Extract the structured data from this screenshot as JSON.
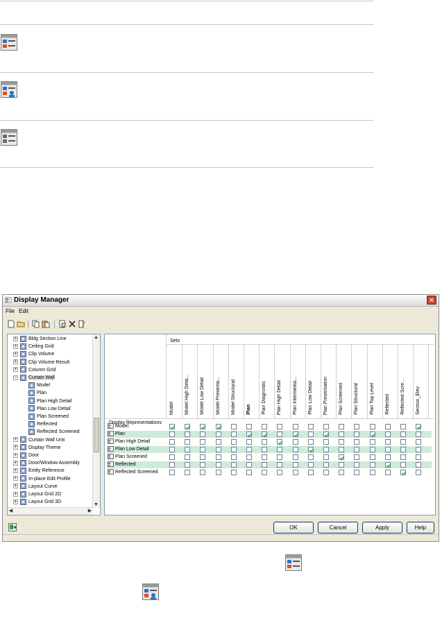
{
  "dialog": {
    "title": "Display Manager",
    "menu": [
      "File",
      "Edit"
    ],
    "close_glyph": "✕",
    "icons": {
      "app": "display-manager-icon",
      "toolbar": [
        "new-icon",
        "open-icon",
        "copy-icon",
        "paste-icon",
        "attach-icon",
        "delete-icon",
        "edit-icon"
      ],
      "export": "export-icon"
    }
  },
  "tree": {
    "items": [
      {
        "label": "Bldg Section Line",
        "level": 0,
        "expander": "+"
      },
      {
        "label": "Ceiling Grid",
        "level": 0,
        "expander": "+"
      },
      {
        "label": "Clip Volume",
        "level": 0,
        "expander": "+"
      },
      {
        "label": "Clip Volume Result",
        "level": 0,
        "expander": "+"
      },
      {
        "label": "Column Grid",
        "level": 0,
        "expander": "+"
      },
      {
        "label": "Curtain Wall",
        "level": 0,
        "expander": "−",
        "selected": true
      },
      {
        "label": "Model",
        "level": 1
      },
      {
        "label": "Plan",
        "level": 1
      },
      {
        "label": "Plan High Detail",
        "level": 1
      },
      {
        "label": "Plan Low Detail",
        "level": 1
      },
      {
        "label": "Plan Screened",
        "level": 1
      },
      {
        "label": "Reflected",
        "level": 1
      },
      {
        "label": "Reflected Screened",
        "level": 1
      },
      {
        "label": "Curtain Wall Unit",
        "level": 0,
        "expander": "+"
      },
      {
        "label": "Display Theme",
        "level": 0,
        "expander": "+"
      },
      {
        "label": "Door",
        "level": 0,
        "expander": "+"
      },
      {
        "label": "Door/Window Assembly",
        "level": 0,
        "expander": "+"
      },
      {
        "label": "Entity Reference",
        "level": 0,
        "expander": "+"
      },
      {
        "label": "In-place Edit Profile",
        "level": 0,
        "expander": "+"
      },
      {
        "label": "Layout Curve",
        "level": 0,
        "expander": "+"
      },
      {
        "label": "Layout Grid 2D",
        "level": 0,
        "expander": "+"
      },
      {
        "label": "Layout Grid 3D",
        "level": 0,
        "expander": "+"
      }
    ]
  },
  "grid": {
    "sets_label": "Sets",
    "reps_label": "Display Representations",
    "columns": [
      {
        "label": "Model"
      },
      {
        "label": "Model High Deta..."
      },
      {
        "label": "Model Low Detail"
      },
      {
        "label": "Model Presenta..."
      },
      {
        "label": "Model Structural"
      },
      {
        "label": "Plan",
        "bold": true
      },
      {
        "label": "Plan Diagnostic"
      },
      {
        "label": "Plan High Detail"
      },
      {
        "label": "Plan Intermedia..."
      },
      {
        "label": "Plan Low Detail"
      },
      {
        "label": "Plan Presentation"
      },
      {
        "label": "Plan Screened"
      },
      {
        "label": "Plan Structural"
      },
      {
        "label": "Plan Top Level"
      },
      {
        "label": "Reflected"
      },
      {
        "label": "Reflected Scre..."
      },
      {
        "label": "Section_Elev"
      }
    ],
    "rows": [
      {
        "label": "Model",
        "highlight": false,
        "checked": [
          1,
          1,
          1,
          1,
          0,
          0,
          0,
          0,
          0,
          0,
          0,
          0,
          0,
          0,
          0,
          0,
          1
        ]
      },
      {
        "label": "Plan",
        "highlight": true,
        "checked": [
          0,
          0,
          0,
          0,
          0,
          1,
          1,
          0,
          1,
          0,
          1,
          0,
          0,
          1,
          0,
          0,
          0
        ]
      },
      {
        "label": "Plan High Detail",
        "highlight": false,
        "checked": [
          0,
          0,
          0,
          0,
          0,
          0,
          0,
          1,
          0,
          0,
          0,
          0,
          0,
          0,
          0,
          0,
          0
        ]
      },
      {
        "label": "Plan Low Detail",
        "highlight": true,
        "checked": [
          0,
          0,
          0,
          0,
          0,
          0,
          0,
          0,
          0,
          1,
          0,
          0,
          0,
          0,
          0,
          0,
          0
        ]
      },
      {
        "label": "Plan Screened",
        "highlight": false,
        "checked": [
          0,
          0,
          0,
          0,
          0,
          0,
          0,
          0,
          0,
          0,
          0,
          1,
          0,
          0,
          0,
          0,
          0
        ]
      },
      {
        "label": "Reflected",
        "highlight": true,
        "checked": [
          0,
          0,
          0,
          0,
          0,
          0,
          0,
          0,
          0,
          0,
          0,
          0,
          0,
          0,
          1,
          0,
          0
        ]
      },
      {
        "label": "Reflected Screened",
        "highlight": false,
        "checked": [
          0,
          0,
          0,
          0,
          0,
          0,
          0,
          0,
          0,
          0,
          0,
          0,
          0,
          0,
          0,
          1,
          0
        ]
      }
    ]
  },
  "buttons": {
    "ok": "OK",
    "cancel": "Cancel",
    "apply": "Apply",
    "help": "Help"
  },
  "doc_icons": [
    "display-set-icon",
    "display-configuration-icon",
    "display-set-icon",
    "display-set-icon",
    "display-configuration-icon"
  ],
  "colors": {
    "accent_blue": "#2f6fc9",
    "accent_orange": "#e0501e",
    "row_highlight": "#cdebd9",
    "check_green": "#2aa54a"
  }
}
